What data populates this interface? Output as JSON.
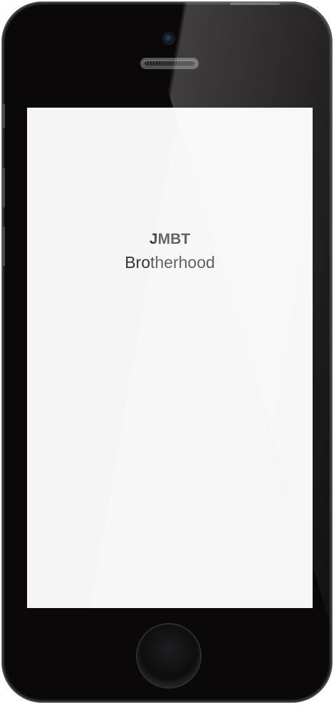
{
  "device": {
    "model": "iPhone"
  },
  "app": {
    "title": "JMBT",
    "subtitle": "Brotherhood",
    "background_color": "#f5f5f5",
    "text_color": "#333333"
  },
  "icons": {
    "camera": "camera-icon",
    "speaker": "speaker-grille",
    "home": "home-button"
  }
}
